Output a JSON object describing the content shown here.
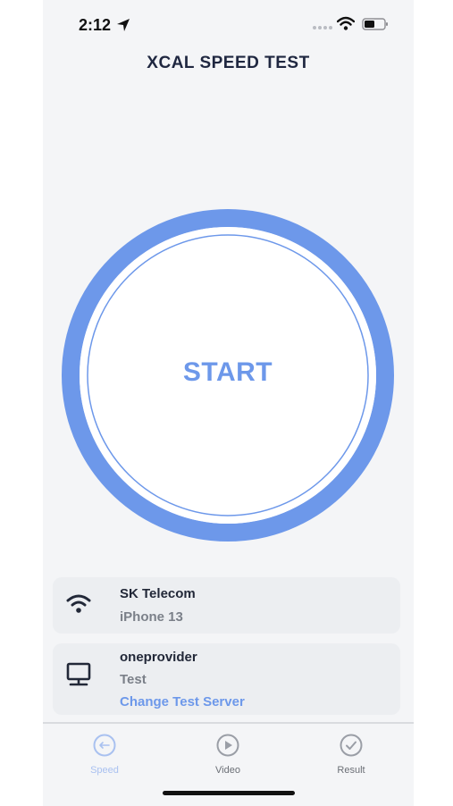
{
  "status_bar": {
    "time": "2:12"
  },
  "app": {
    "title": "XCAL SPEED TEST"
  },
  "start_button": {
    "label": "START"
  },
  "network_card": {
    "provider": "SK Telecom",
    "device": "iPhone 13"
  },
  "server_card": {
    "name": "oneprovider",
    "location": "Test",
    "change_label": "Change Test Server"
  },
  "tabs": [
    {
      "label": "Speed",
      "icon": "speed-icon",
      "active": true
    },
    {
      "label": "Video",
      "icon": "play-icon",
      "active": false
    },
    {
      "label": "Result",
      "icon": "check-icon",
      "active": false
    }
  ],
  "colors": {
    "accent": "#6d98ea",
    "tab_active": "#a9c1f0",
    "tab_inactive": "#9a9ea6"
  }
}
